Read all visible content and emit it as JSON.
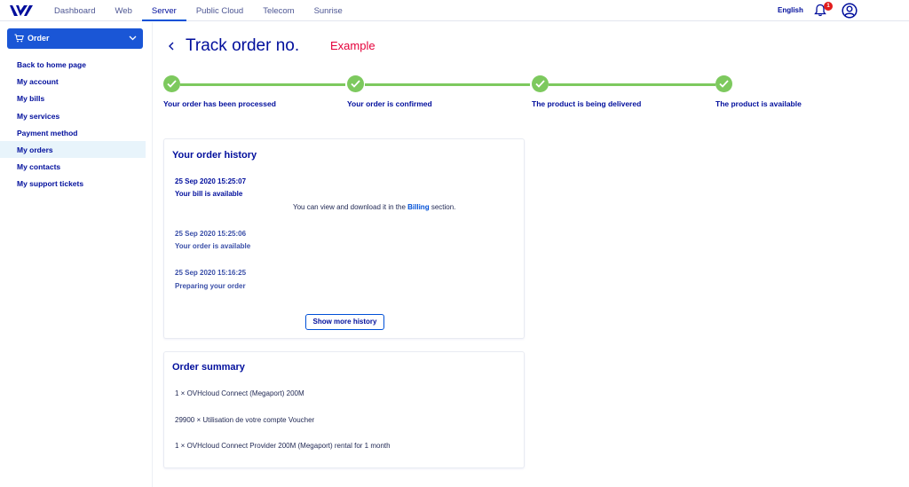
{
  "topbar": {
    "logo": "ovh-logo",
    "nav": [
      {
        "label": "Dashboard",
        "active": false
      },
      {
        "label": "Web",
        "active": false
      },
      {
        "label": "Server",
        "active": true
      },
      {
        "label": "Public Cloud",
        "active": false
      },
      {
        "label": "Telecom",
        "active": false
      },
      {
        "label": "Sunrise",
        "active": false
      }
    ],
    "language": "English",
    "notifications_count": "1",
    "bell_icon": "bell-icon",
    "user_icon": "user-circle-icon"
  },
  "sidebar": {
    "order_button": "Order",
    "items": [
      {
        "label": "Back to home page",
        "active": false
      },
      {
        "label": "My account",
        "active": false
      },
      {
        "label": "My bills",
        "active": false
      },
      {
        "label": "My services",
        "active": false
      },
      {
        "label": "Payment method",
        "active": false
      },
      {
        "label": "My orders",
        "active": true
      },
      {
        "label": "My contacts",
        "active": false
      },
      {
        "label": "My support tickets",
        "active": false
      }
    ]
  },
  "page": {
    "title": "Track order no.",
    "annotation": "Example"
  },
  "progress": {
    "steps": [
      {
        "label": "Your order has been processed",
        "done": true
      },
      {
        "label": "Your order is confirmed",
        "done": true
      },
      {
        "label": "The product is being delivered",
        "done": true
      },
      {
        "label": "The product is available",
        "done": true
      }
    ]
  },
  "history": {
    "title": "Your order history",
    "entries": [
      {
        "date": "25 Sep 2020 15:25:07",
        "status": "Your bill is available",
        "message_prefix": "You can view and download it in the",
        "message_link": "Billing",
        "message_suffix": "section."
      },
      {
        "date": "25 Sep 2020 15:25:06",
        "status": "Your order is available"
      },
      {
        "date": "25 Sep 2020 15:16:25",
        "status": "Preparing your order"
      }
    ],
    "show_more": "Show more history"
  },
  "summary": {
    "title": "Order summary",
    "lines": [
      "1 × OVHcloud Connect (Megaport) 200M",
      "29900 × Utilisation de votre compte Voucher",
      "1 × OVHcloud Connect Provider 200M (Megaport) rental for 1 month"
    ]
  },
  "colors": {
    "primary": "#000e9c",
    "accent": "#0050d7",
    "success": "#7dc95e",
    "annotation": "#e4003a",
    "badge": "#e21c1c"
  }
}
